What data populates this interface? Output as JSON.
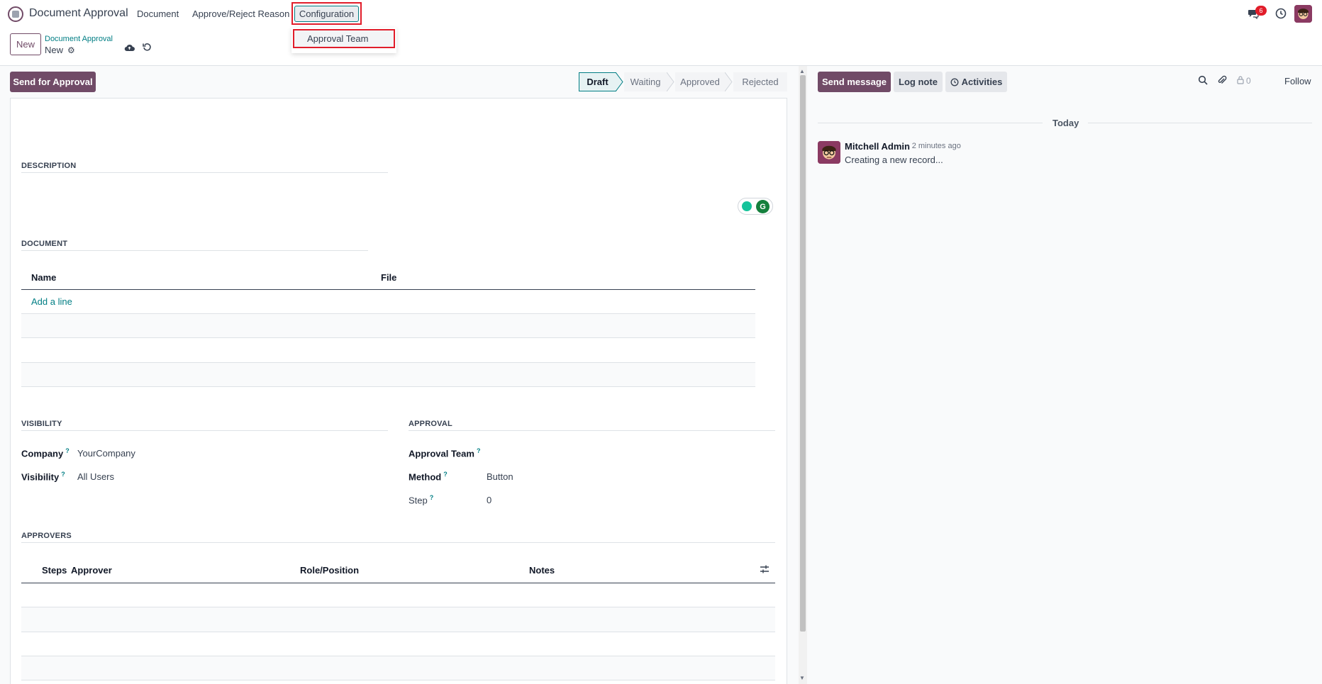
{
  "navbar": {
    "app_name": "Document Approval",
    "menu": [
      "Document",
      "Approve/Reject Reason",
      "Configuration"
    ],
    "dropdown_item": "Approval Team",
    "messages_badge": "6"
  },
  "control_panel": {
    "new_label": "New",
    "breadcrumb_parent": "Document Approval",
    "breadcrumb_current": "New"
  },
  "form": {
    "primary_button": "Send for Approval",
    "stages": [
      "Draft",
      "Waiting",
      "Approved",
      "Rejected"
    ],
    "active_stage": "Draft",
    "sections": {
      "description": "DESCRIPTION",
      "document": "DOCUMENT",
      "visibility": "VISIBILITY",
      "approval": "APPROVAL",
      "approvers": "APPROVERS"
    },
    "document_table": {
      "columns": [
        "Name",
        "File"
      ],
      "add_line": "Add a line"
    },
    "visibility": {
      "company_label": "Company",
      "company_value": "YourCompany",
      "visibility_label": "Visibility",
      "visibility_value": "All Users"
    },
    "approval": {
      "team_label": "Approval Team",
      "team_value": "",
      "method_label": "Method",
      "method_value": "Button",
      "step_label": "Step",
      "step_value": "0"
    },
    "approvers_table": {
      "columns": [
        "Steps",
        "Approver",
        "Role/Position",
        "Notes"
      ]
    },
    "help_mark": "?"
  },
  "chatter": {
    "send_message": "Send message",
    "log_note": "Log note",
    "activities": "Activities",
    "follower_count": "0",
    "follow": "Follow",
    "date_separator": "Today",
    "message": {
      "author": "Mitchell Admin",
      "date": "- 2 minutes ago",
      "body": "Creating a new record..."
    }
  },
  "colors": {
    "brand": "#714b67",
    "accent": "#017e84",
    "highlight_box": "#e11d2a"
  }
}
